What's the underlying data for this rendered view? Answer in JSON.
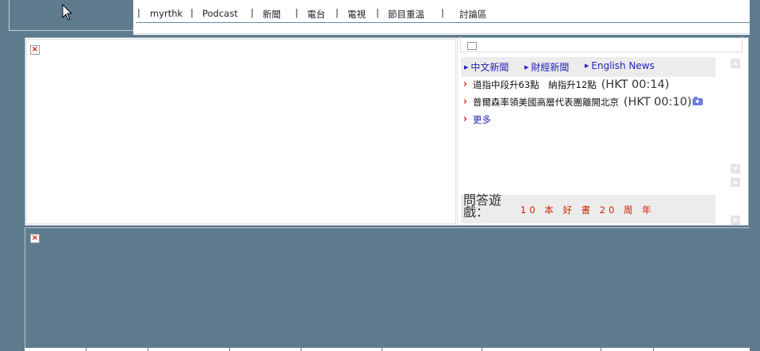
{
  "nav": {
    "items": [
      {
        "label": "myrthk"
      },
      {
        "label": "Podcast"
      },
      {
        "label": "新聞"
      },
      {
        "label": "電台"
      },
      {
        "label": "電視"
      },
      {
        "label": "節目重溫"
      },
      {
        "label": "討論區"
      }
    ],
    "separator": "|"
  },
  "tabs": [
    {
      "label": "中文新聞"
    },
    {
      "label": "財經新聞"
    },
    {
      "label": "English News"
    }
  ],
  "news": [
    {
      "headline": "道指中段升63點　納指升12點",
      "time": "(HKT 00:14)"
    },
    {
      "headline": "普爾森率領美國高層代表團離開北京",
      "time": "(HKT 00:10)"
    }
  ],
  "more_label": "更多",
  "quiz": {
    "label": "問答遊戲：",
    "title": "10 本 好 書 20 周 年"
  },
  "colors": {
    "background": "#5f7b8e",
    "link": "#2222bb",
    "accent_red": "#cc0000",
    "quiz_red": "#cc2200"
  },
  "icons": {
    "broken_image": "broken-image-icon",
    "camera": "camera-icon",
    "chevron": "chevron-right-icon",
    "cursor": "mouse-pointer-icon"
  }
}
